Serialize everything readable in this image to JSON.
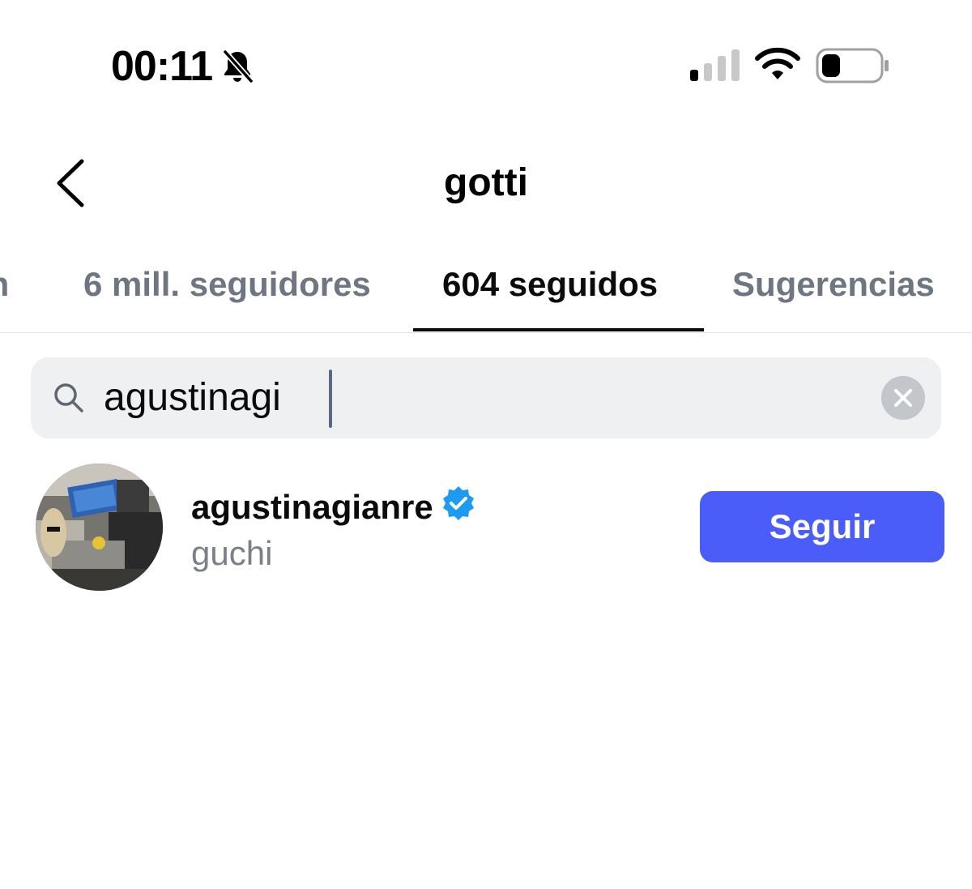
{
  "status_bar": {
    "time": "00:11",
    "icons": [
      "bell-slash-icon",
      "cellular-signal-icon",
      "wifi-icon",
      "battery-icon"
    ]
  },
  "header": {
    "back_icon": "chevron-left-icon",
    "title": "gotti"
  },
  "tabs": [
    {
      "label": "un",
      "active": false
    },
    {
      "label": "6 mill. seguidores",
      "active": false
    },
    {
      "label": "604 seguidos",
      "active": true
    },
    {
      "label": "Sugerencias",
      "active": false
    }
  ],
  "search": {
    "value": "agustinagi",
    "icon": "search-icon",
    "clear_icon": "clear-icon"
  },
  "results": [
    {
      "username": "agustinagianre",
      "verified": true,
      "full_name": "guchi",
      "button_label": "Seguir"
    }
  ],
  "colors": {
    "accent": "#4a5df9",
    "verified": "#1d9bf0",
    "muted_text": "#6e7681",
    "search_bg": "#eef0f2"
  }
}
